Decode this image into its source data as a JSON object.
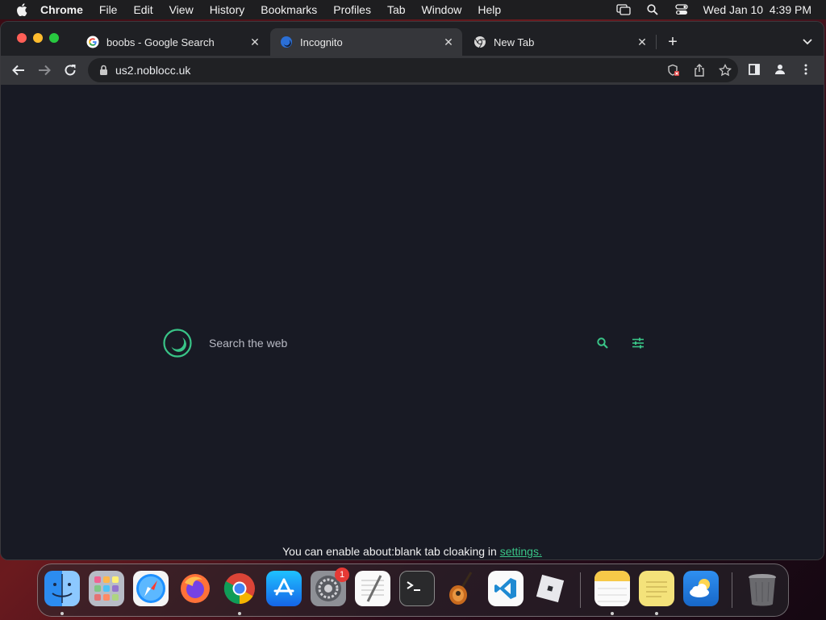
{
  "menubar": {
    "app_name": "Chrome",
    "items": [
      "File",
      "Edit",
      "View",
      "History",
      "Bookmarks",
      "Profiles",
      "Tab",
      "Window",
      "Help"
    ],
    "clock": "Wed Jan 10  4:39 PM"
  },
  "tabs": [
    {
      "title": "boobs - Google Search",
      "icon": "google-g-icon",
      "active": false
    },
    {
      "title": "Incognito",
      "icon": "incognito-moon-icon",
      "active": true
    },
    {
      "title": "New Tab",
      "icon": "chrome-icon",
      "active": false
    }
  ],
  "omnibox": {
    "url": "us2.noblocc.uk"
  },
  "page": {
    "search_placeholder": "Search the web",
    "note_prefix": "You can enable about:blank tab cloaking in ",
    "note_link": "settings."
  },
  "colors": {
    "accent": "#39c487",
    "page_bg": "#181a24",
    "toolbar_bg": "#35363a"
  },
  "dock": {
    "apps": [
      {
        "name": "Finder",
        "icon": "finder-icon",
        "running": true
      },
      {
        "name": "Launchpad",
        "icon": "launchpad-icon",
        "running": false
      },
      {
        "name": "Safari",
        "icon": "safari-icon",
        "running": false
      },
      {
        "name": "Firefox",
        "icon": "firefox-icon",
        "running": false
      },
      {
        "name": "Google Chrome",
        "icon": "chrome-icon",
        "running": true
      },
      {
        "name": "App Store",
        "icon": "app-store-icon",
        "running": false
      },
      {
        "name": "System Settings",
        "icon": "system-settings-icon",
        "running": false,
        "badge": "1"
      },
      {
        "name": "TextEdit",
        "icon": "textedit-icon",
        "running": false
      },
      {
        "name": "Terminal",
        "icon": "terminal-icon",
        "running": false
      },
      {
        "name": "GarageBand",
        "icon": "garageband-icon",
        "running": false
      },
      {
        "name": "Visual Studio Code",
        "icon": "vscode-icon",
        "running": false
      },
      {
        "name": "Roblox",
        "icon": "roblox-icon",
        "running": false
      },
      {
        "name": "Notes",
        "icon": "notes-icon",
        "running": true
      },
      {
        "name": "Stickies",
        "icon": "stickies-icon",
        "running": true
      },
      {
        "name": "Weather",
        "icon": "weather-icon",
        "running": false
      },
      {
        "name": "Trash",
        "icon": "trash-icon",
        "running": false
      }
    ]
  }
}
